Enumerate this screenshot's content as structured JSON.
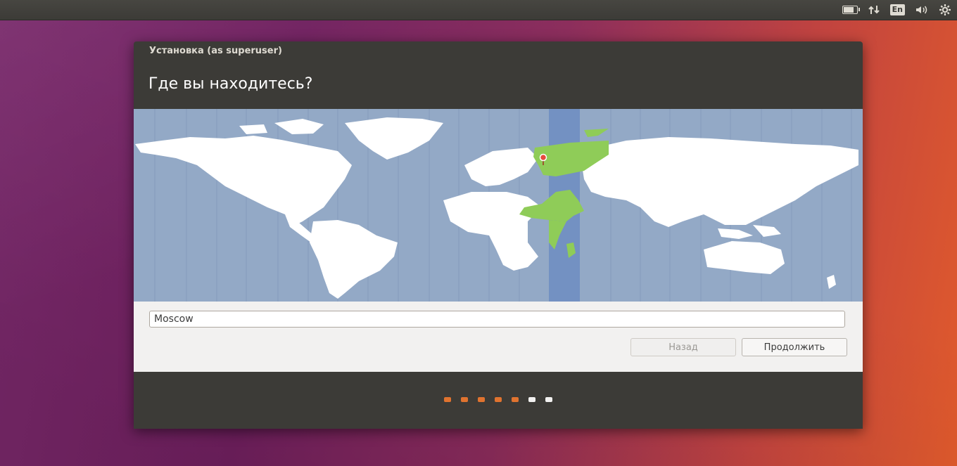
{
  "topbar": {
    "icons": [
      "battery-icon",
      "network-arrows-icon",
      "keyboard-language-indicator",
      "volume-icon",
      "settings-gear-icon"
    ],
    "language": "En",
    "battery_level": 0.8
  },
  "window": {
    "title": "Установка (as superuser)",
    "heading": "Где вы находитесь?"
  },
  "map": {
    "selected_city": "Moscow",
    "colors": {
      "ocean": "#93a9c6",
      "land": "#ffffff",
      "selected_zone_band": "#7391c2",
      "selected_zone_land": "#8fcc58",
      "pin": "#e64b3c"
    }
  },
  "location": {
    "value": "Moscow"
  },
  "buttons": {
    "back": "Назад",
    "next": "Продолжить"
  },
  "progress": {
    "total_steps": 7,
    "completed_steps": 5,
    "active_color": "#e0732f",
    "inactive_color": "#f2f1f0"
  }
}
